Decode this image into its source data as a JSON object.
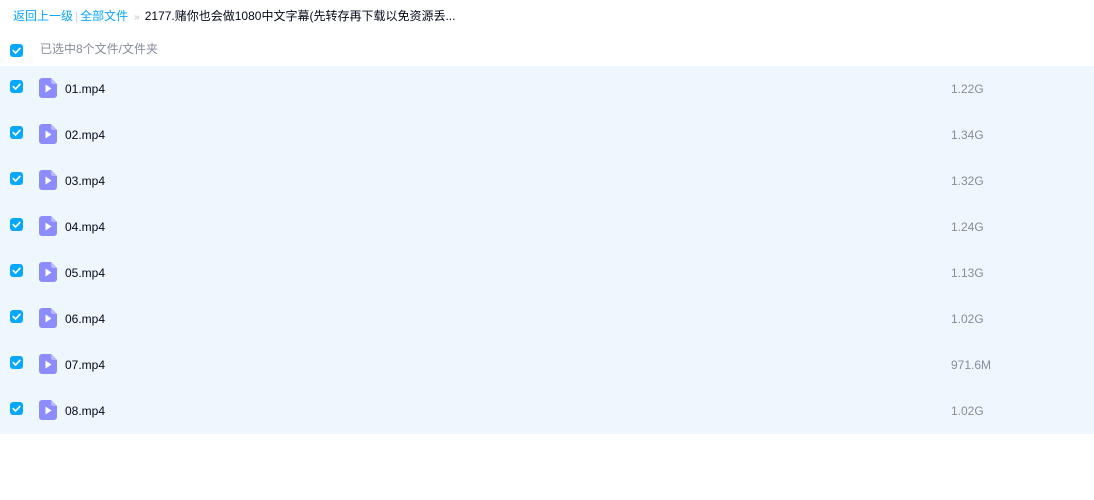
{
  "breadcrumb": {
    "back_label": "返回上一级",
    "separator": "|",
    "all_files_label": "全部文件",
    "arrow": "»",
    "current_folder": "2177.赌你也会做1080中文字幕(先转存再下载以免资源丢..."
  },
  "selection": {
    "status_text": "已选中8个文件/文件夹"
  },
  "colors": {
    "accent": "#06a7ff",
    "list_background": "#eff7fe",
    "video_icon": "#8c8cff"
  },
  "icons": {
    "checkbox": "checkbox-checked-icon",
    "file": "video-file-icon"
  },
  "files": [
    {
      "name": "01.mp4",
      "size": "1.22G"
    },
    {
      "name": "02.mp4",
      "size": "1.34G"
    },
    {
      "name": "03.mp4",
      "size": "1.32G"
    },
    {
      "name": "04.mp4",
      "size": "1.24G"
    },
    {
      "name": "05.mp4",
      "size": "1.13G"
    },
    {
      "name": "06.mp4",
      "size": "1.02G"
    },
    {
      "name": "07.mp4",
      "size": "971.6M"
    },
    {
      "name": "08.mp4",
      "size": "1.02G"
    }
  ]
}
